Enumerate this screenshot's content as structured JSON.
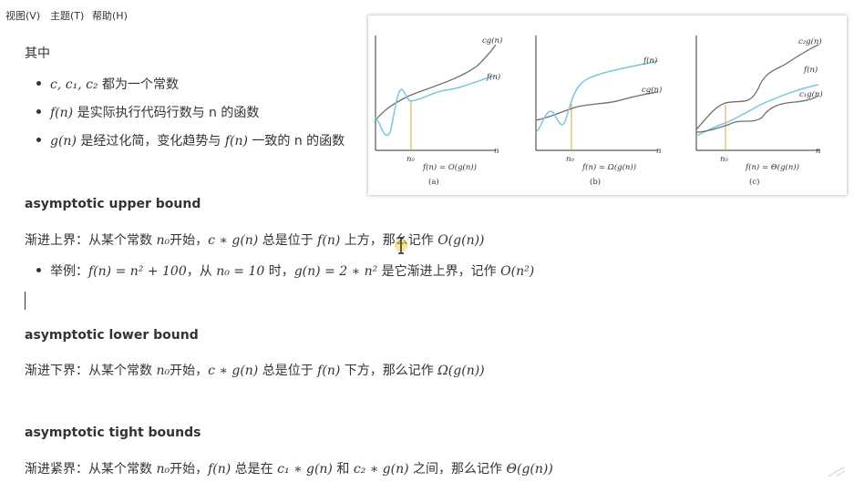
{
  "menubar": {
    "items": [
      {
        "label": "视图(V)"
      },
      {
        "label": "主题(T)"
      },
      {
        "label": "帮助(H)"
      }
    ]
  },
  "intro": {
    "title": "其中",
    "bullets": [
      {
        "math": "c, c₁, c₂",
        "text": " 都为一个常数"
      },
      {
        "math": "f(n)",
        "text": " 是实际执行代码行数与 n 的函数"
      },
      {
        "math_a": "g(n)",
        "text_a": " 是经过化简，变化趋势与 ",
        "math_b": "f(n)",
        "text_b": " 一致的 n 的函数"
      }
    ]
  },
  "figure": {
    "panels": [
      {
        "upper_label": "cg(n)",
        "lower_label": "f(n)",
        "n0": "n₀",
        "axis_n": "n",
        "formula": "f(n) = O(g(n))",
        "caption": "(a)"
      },
      {
        "upper_label": "f(n)",
        "lower_label": "cg(n)",
        "n0": "n₀",
        "axis_n": "n",
        "formula": "f(n) = Ω(g(n))",
        "caption": "(b)"
      },
      {
        "upper_label": "c₂g(n)",
        "mid_label": "f(n)",
        "lower_label": "c₁g(n)",
        "n0": "n₀",
        "axis_n": "n",
        "formula": "f(n) = Θ(g(n))",
        "caption": "(c)"
      }
    ],
    "colors": {
      "fn": "#7cc6dd",
      "gn": "#6e6e6e",
      "n0_line": "#e0a040",
      "axis": "#333333"
    }
  },
  "upper": {
    "heading": "asymptotic upper bound",
    "line1": {
      "a": "渐进上界：从某个常数 ",
      "m1": "n₀",
      "b": "开始，",
      "m2": "c ∗ g(n)",
      "c": " 总是位于 ",
      "m3": "f(n)",
      "d": " 上方，那么记作 ",
      "m4": "O(g(n))"
    },
    "example": {
      "a": "举例：",
      "m1": "f(n) = n² + 100",
      "b": "，从 ",
      "m2": "n₀ = 10",
      "c": " 时，",
      "m3": "g(n) = 2 ∗ n²",
      "d": " 是它渐进上界，记作 ",
      "m4": "O(n²)"
    }
  },
  "lower": {
    "heading": "asymptotic lower bound",
    "line1": {
      "a": "渐进下界：从某个常数 ",
      "m1": "n₀",
      "b": "开始，",
      "m2": "c ∗ g(n)",
      "c": " 总是位于 ",
      "m3": "f(n)",
      "d": " 下方，那么记作 ",
      "m4": "Ω(g(n))"
    }
  },
  "tight": {
    "heading": "asymptotic tight bounds",
    "line1": {
      "a": "渐进紧界：从某个常数 ",
      "m1": "n₀",
      "b": "开始，",
      "m2": "f(n)",
      "c": " 总是在 ",
      "m3": "c₁ ∗ g(n)",
      "d": " 和 ",
      "m4": "c₂ ∗ g(n)",
      "e": " 之间，那么记作 ",
      "m5": "Θ(g(n))"
    }
  }
}
